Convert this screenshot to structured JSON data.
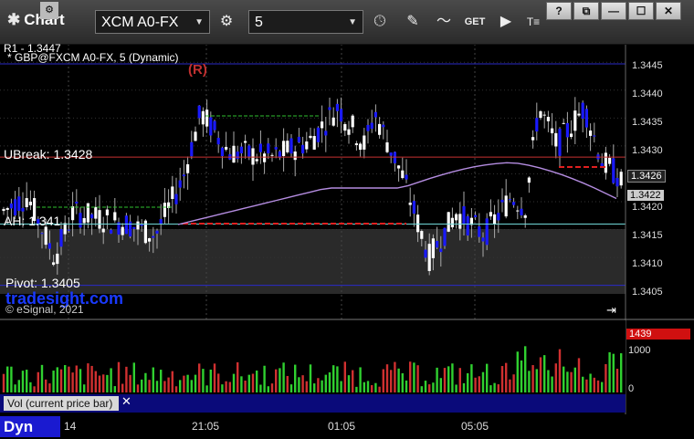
{
  "window": {
    "title": "Chart",
    "symbol": "XCM A0-FX",
    "interval": "5",
    "win_buttons": [
      "?",
      "⧉",
      "—",
      "☐",
      "✕"
    ]
  },
  "chart": {
    "r1_label": "R1 - 1.3447",
    "symbol_line": "* GBP@FXCM A0-FX, 5 (Dynamic)",
    "ubreak_label": "UBreak: 1.3428",
    "ah_label": "AH: 1.341",
    "pivot_label": "Pivot: 1.3405",
    "watermark": "tradesight.com",
    "copyright": "© eSignal, 2021",
    "signal_R": "(R)",
    "price_axis": [
      "1.3445",
      "1.3440",
      "1.3435",
      "1.3430",
      "1.3425",
      "1.3420",
      "1.3415",
      "1.3410",
      "1.3405"
    ],
    "price_tag_1": "1.3426",
    "price_tag_2": "1.3422",
    "colors": {
      "up": "#ffffff",
      "down": "#1a1aff",
      "r1": "#2a2ac8",
      "ubreak": "#c83232",
      "ah": "#6fd6d6",
      "vwap": "#b48ce0"
    }
  },
  "volume": {
    "label": "Vol (current price bar)",
    "close_label": "✕",
    "axis": [
      "1000",
      "0"
    ],
    "current": "1439"
  },
  "time_axis": {
    "dyn_label": "Dyn",
    "labels": [
      "14",
      "21:05",
      "01:05",
      "05:05"
    ]
  },
  "chart_data": {
    "type": "candlestick",
    "ylim": [
      1.3402,
      1.3447
    ],
    "levels": {
      "R1": 1.3447,
      "UBreak": 1.3428,
      "AH": 1.3416,
      "Pivot": 1.3405
    },
    "last_price": 1.3426
  }
}
